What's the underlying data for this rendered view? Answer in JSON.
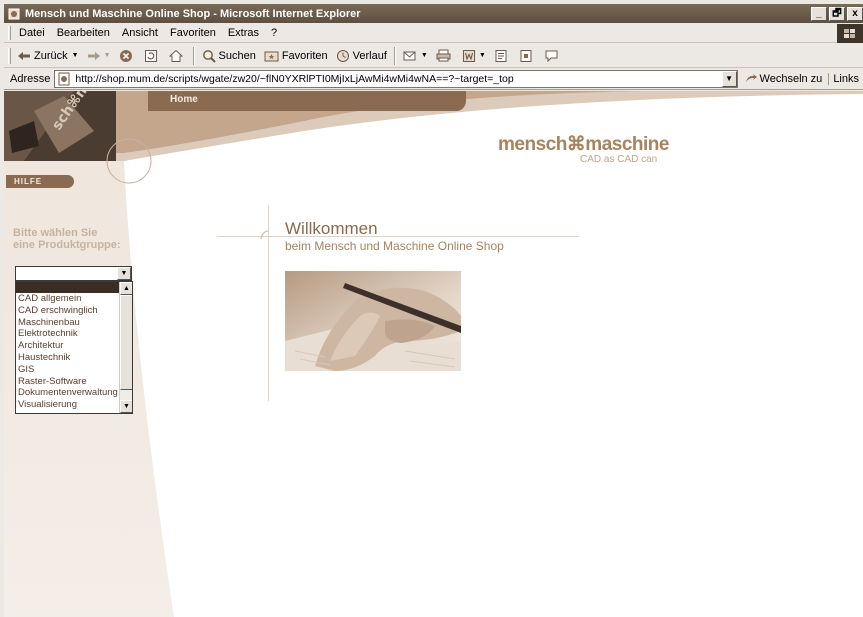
{
  "window": {
    "title": "Mensch und Maschine Online Shop - Microsoft Internet Explorer",
    "controls": [
      "_",
      "🗗",
      "x"
    ]
  },
  "menu": [
    "Datei",
    "Bearbeiten",
    "Ansicht",
    "Favoriten",
    "Extras",
    "?"
  ],
  "toolbar": {
    "back": "Zurück",
    "search": "Suchen",
    "favorites": "Favoriten",
    "history": "Verlauf"
  },
  "address": {
    "label": "Adresse",
    "url": "http://shop.mum.de/scripts/wgate/zw20/~flN0YXRlPTI0MjIxLjAwMi4wMi4wNA==?~target=_top",
    "go": "Wechseln zu",
    "links": "Links"
  },
  "site": {
    "nav_home": "Home",
    "help": "HILFE",
    "brand": "mensch⌘maschine",
    "tagline": "CAD as CAD can",
    "choose_line1": "Bitte wählen Sie",
    "choose_line2": "eine Produktgruppe:",
    "welcome": "Willkommen",
    "welcome_sub": "beim Mensch und Maschine Online Shop",
    "product_groups": [
      "CAD allgemein",
      "CAD erschwinglich",
      "Maschinenbau",
      "Elektrotechnik",
      "Architektur",
      "Haustechnik",
      "GIS",
      "Raster-Software",
      "Dokumentenverwaltung",
      "Visualisierung"
    ]
  },
  "colors": {
    "accent_brown": "#8a6a50",
    "brand_text": "#a7835f",
    "sidebar_bg": "#f1e9e1"
  }
}
